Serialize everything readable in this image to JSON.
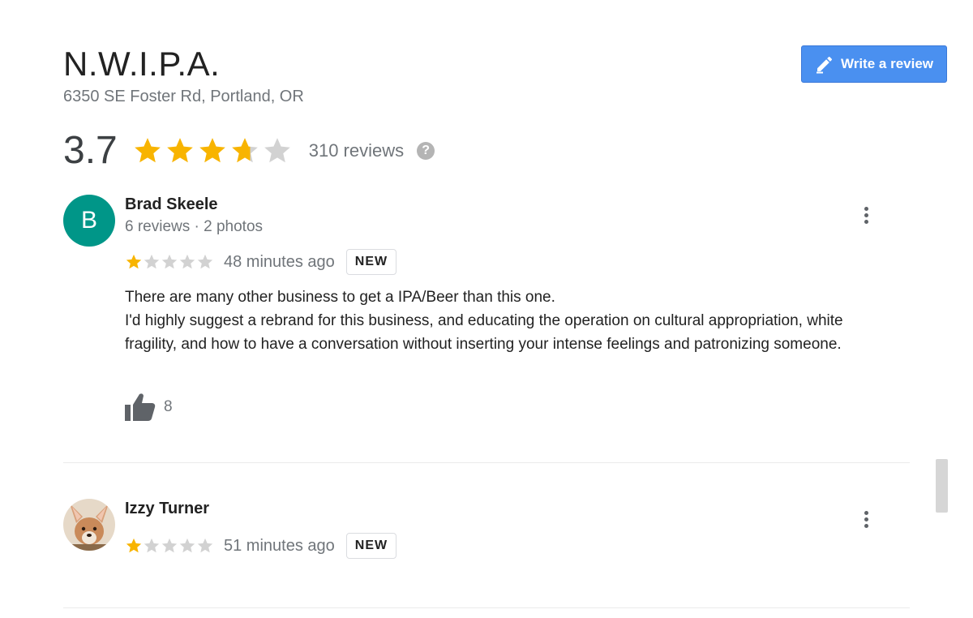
{
  "place": {
    "name": "N.W.I.P.A.",
    "address": "6350 SE Foster Rd, Portland, OR"
  },
  "write_review": {
    "label": "Write a review",
    "icon": "pencil-icon"
  },
  "summary": {
    "rating": "3.7",
    "rating_value": 3.7,
    "review_count_label": "310 reviews",
    "help_glyph": "?"
  },
  "colors": {
    "star_filled": "#f8b400",
    "star_empty": "#d2d2d2",
    "button_blue": "#4a90f0",
    "avatar_teal": "#009688"
  },
  "reviews": [
    {
      "author": "Brad Skeele",
      "avatar_letter": "B",
      "meta": "6 reviews · 2 photos",
      "stars": 1,
      "time_ago": "48 minutes ago",
      "badge": "NEW",
      "text_lines": [
        "There are many other business to get a IPA/Beer than this one.",
        "I'd highly suggest a rebrand for this business, and educating the operation on cultural appropriation, white fragility, and how to have a conversation without inserting your intense feelings and patronizing someone."
      ],
      "likes": "8"
    },
    {
      "author": "Izzy Turner",
      "avatar_type": "dog-photo",
      "stars": 1,
      "time_ago": "51 minutes ago",
      "badge": "NEW"
    }
  ]
}
